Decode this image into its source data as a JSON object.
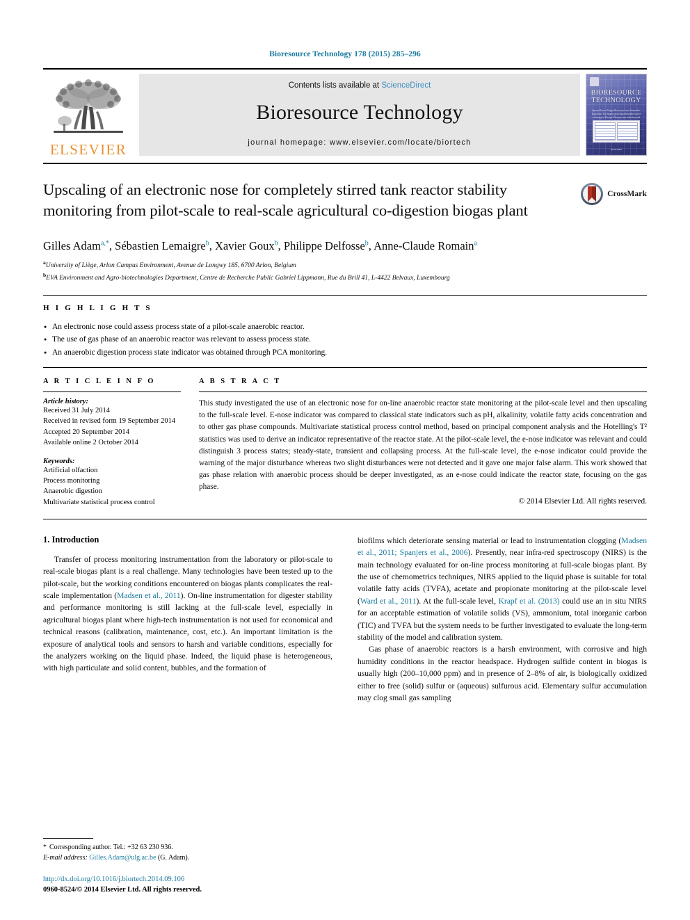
{
  "running_head": "Bioresource Technology 178 (2015) 285–296",
  "masthead": {
    "publisher_name": "ELSEVIER",
    "contents_prefix": "Contents lists available at ",
    "contents_link": "ScienceDirect",
    "journal_name": "Bioresource Technology",
    "homepage": "journal homepage: www.elsevier.com/locate/biortech",
    "cover": {
      "title_line1": "BIORESOURCE",
      "title_line2": "TECHNOLOGY",
      "subtitle": "Special Issue: Biogas Recovery from Anaerobic Digestion. The largest growing renewable source of energy in Europe. Best process selection and best of biofuels",
      "footer": "ELSEVIER"
    }
  },
  "article": {
    "title": "Upscaling of an electronic nose for completely stirred tank reactor stability monitoring from pilot-scale to real-scale agricultural co-digestion biogas plant",
    "crossmark_label": "CrossMark",
    "authors": [
      {
        "name": "Gilles Adam",
        "marks": "a,*"
      },
      {
        "name": "Sébastien Lemaigre",
        "marks": "b"
      },
      {
        "name": "Xavier Goux",
        "marks": "b"
      },
      {
        "name": "Philippe Delfosse",
        "marks": "b"
      },
      {
        "name": "Anne-Claude Romain",
        "marks": "a"
      }
    ],
    "affiliations": [
      {
        "mark": "a",
        "text": "University of Liège, Arlon Campus Environment, Avenue de Longwy 185, 6700 Arlon, Belgium"
      },
      {
        "mark": "b",
        "text": "EVA Environment and Agro-biotechnologies Department, Centre de Recherche Public Gabriel Lippmann, Rue du Brill 41, L-4422 Belvaux, Luxembourg"
      }
    ]
  },
  "highlights": {
    "label": "H I G H L I G H T S",
    "items": [
      "An electronic nose could assess process state of a pilot-scale anaerobic reactor.",
      "The use of gas phase of an anaerobic reactor was relevant to assess process state.",
      "An anaerobic digestion process state indicator was obtained through PCA monitoring."
    ]
  },
  "article_info": {
    "label": "A R T I C L E   I N F O",
    "history_label": "Article history:",
    "history": [
      "Received 31 July 2014",
      "Received in revised form 19 September 2014",
      "Accepted 20 September 2014",
      "Available online 2 October 2014"
    ],
    "keywords_label": "Keywords:",
    "keywords": [
      "Artificial olfaction",
      "Process monitoring",
      "Anaerobic digestion",
      "Multivariate statistical process control"
    ]
  },
  "abstract": {
    "label": "A B S T R A C T",
    "text": "This study investigated the use of an electronic nose for on-line anaerobic reactor state monitoring at the pilot-scale level and then upscaling to the full-scale level. E-nose indicator was compared to classical state indicators such as pH, alkalinity, volatile fatty acids concentration and to other gas phase compounds. Multivariate statistical process control method, based on principal component analysis and the Hotelling's T² statistics was used to derive an indicator representative of the reactor state. At the pilot-scale level, the e-nose indicator was relevant and could distinguish 3 process states; steady-state, transient and collapsing process. At the full-scale level, the e-nose indicator could provide the warning of the major disturbance whereas two slight disturbances were not detected and it gave one major false alarm. This work showed that gas phase relation with anaerobic process should be deeper investigated, as an e-nose could indicate the reactor state, focusing on the gas phase.",
    "copyright": "© 2014 Elsevier Ltd. All rights reserved."
  },
  "introduction": {
    "heading": "1. Introduction",
    "left_paragraph_1_a": "Transfer of process monitoring instrumentation from the laboratory or pilot-scale to real-scale biogas plant is a real challenge. Many technologies have been tested up to the pilot-scale, but the working conditions encountered on biogas plants complicates the real-scale implementation (",
    "left_cite_1": "Madsen et al., 2011",
    "left_paragraph_1_b": "). On-line instrumentation for digester stability and performance monitoring is still lacking at the full-scale level, especially in agricultural biogas plant where high-tech instrumentation is not used for economical and technical reasons (calibration, maintenance, cost, etc.). An important limitation is the exposure of analytical tools and sensors to harsh and variable conditions, especially for the analyzers working on the liquid phase. Indeed, the liquid phase is heterogeneous, with high particulate and solid content, bubbles, and the formation of",
    "right_paragraph_1_a": "biofilms which deteriorate sensing material or lead to instrumentation clogging (",
    "right_cite_1": "Madsen et al., 2011; Spanjers et al., 2006",
    "right_paragraph_1_b": "). Presently, near infra-red spectroscopy (NIRS) is the main technology evaluated for on-line process monitoring at full-scale biogas plant. By the use of chemometrics techniques, NIRS applied to the liquid phase is suitable for total volatile fatty acids (TVFA), acetate and propionate monitoring at the pilot-scale level (",
    "right_cite_2": "Ward et al., 2011",
    "right_paragraph_1_c": "). At the full-scale level, ",
    "right_cite_3": "Krapf et al. (2013)",
    "right_paragraph_1_d": " could use an in situ NIRS for an acceptable estimation of volatile solids (VS), ammonium, total inorganic carbon (TIC) and TVFA but the system needs to be further investigated to evaluate the long-term stability of the model and calibration system.",
    "right_paragraph_2": "Gas phase of anaerobic reactors is a harsh environment, with corrosive and high humidity conditions in the reactor headspace. Hydrogen sulfide content in biogas is usually high (200–10,000 ppm) and in presence of 2–8% of air, is biologically oxidized either to free (solid) sulfur or (aqueous) sulfurous acid. Elementary sulfur accumulation may clog small gas sampling"
  },
  "footer": {
    "corresponding_star": "*",
    "corresponding_text": "Corresponding author. Tel.: +32 63 230 936.",
    "email_label": "E-mail address:",
    "email": "Gilles.Adam@ulg.ac.be",
    "email_suffix": "(G. Adam).",
    "doi": "http://dx.doi.org/10.1016/j.biortech.2014.09.106",
    "issn_line": "0960-8524/© 2014 Elsevier Ltd. All rights reserved."
  },
  "colors": {
    "link": "#1a7a9e",
    "elsevier_orange": "#E8912D",
    "band_gray": "#e6e6e6"
  }
}
